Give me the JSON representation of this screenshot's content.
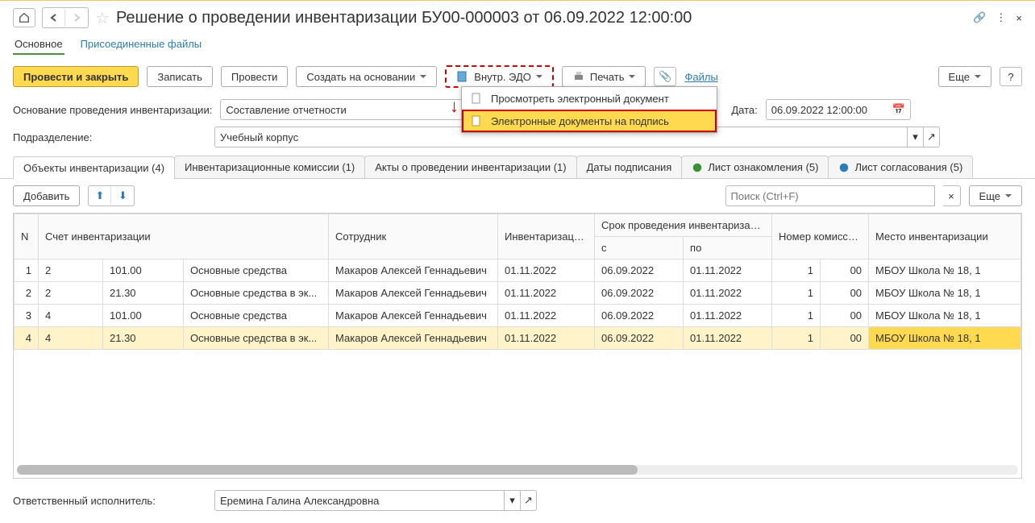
{
  "title": "Решение о проведении инвентаризации БУ00-000003 от 06.09.2022 12:00:00",
  "nav_tabs": {
    "main": "Основное",
    "attached": "Присоединенные файлы"
  },
  "toolbar": {
    "post_close": "Провести и закрыть",
    "save": "Записать",
    "post": "Провести",
    "create_based": "Создать на основании",
    "edo": "Внутр. ЭДО",
    "print": "Печать",
    "files": "Файлы",
    "more": "Еще"
  },
  "dropdown": {
    "view": "Просмотреть электронный документ",
    "sign": "Электронные документы на подпись"
  },
  "fields": {
    "basis_label": "Основание проведения инвентаризации:",
    "basis_value": "Составление отчетности",
    "date_label": "Дата:",
    "date_value": "06.09.2022 12:00:00",
    "dept_label": "Подразделение:",
    "dept_value": "Учебный корпус",
    "responsible_label": "Ответственный исполнитель:",
    "responsible_value": "Еремина Галина Александровна"
  },
  "sub_tabs": {
    "objects": "Объекты инвентаризации (4)",
    "commissions": "Инвентаризационные комиссии (1)",
    "acts": "Акты о проведении инвентаризации (1)",
    "sign_dates": "Даты подписания",
    "ack_sheet": "Лист ознакомления (5)",
    "approval_sheet": "Лист согласования (5)"
  },
  "grid_toolbar": {
    "add": "Добавить",
    "search_ph": "Поиск (Ctrl+F)",
    "more": "Еще"
  },
  "columns": {
    "n": "N",
    "account": "Счет инвентаризации",
    "employee": "Сотрудник",
    "inv_date": "Инвентаризация по состоянию на",
    "period": "Срок проведения инвентаризации",
    "from": "с",
    "to": "по",
    "commission": "Номер комиссии / рабочей комиссии",
    "place": "Место инвентаризации"
  },
  "rows": [
    {
      "n": "1",
      "a": "2",
      "b": "101.00",
      "c": "Основные средства",
      "emp": "Макаров Алексей Геннадьевич",
      "inv": "01.11.2022",
      "from": "06.09.2022",
      "to": "01.11.2022",
      "k1": "1",
      "k2": "00",
      "place": "МБОУ Школа № 18, 1"
    },
    {
      "n": "2",
      "a": "2",
      "b": "21.30",
      "c": "Основные средства в эк...",
      "emp": "Макаров Алексей Геннадьевич",
      "inv": "01.11.2022",
      "from": "06.09.2022",
      "to": "01.11.2022",
      "k1": "1",
      "k2": "00",
      "place": "МБОУ Школа № 18, 1"
    },
    {
      "n": "3",
      "a": "4",
      "b": "101.00",
      "c": "Основные средства",
      "emp": "Макаров Алексей Геннадьевич",
      "inv": "01.11.2022",
      "from": "06.09.2022",
      "to": "01.11.2022",
      "k1": "1",
      "k2": "00",
      "place": "МБОУ Школа № 18, 1"
    },
    {
      "n": "4",
      "a": "4",
      "b": "21.30",
      "c": "Основные средства в эк...",
      "emp": "Макаров Алексей Геннадьевич",
      "inv": "01.11.2022",
      "from": "06.09.2022",
      "to": "01.11.2022",
      "k1": "1",
      "k2": "00",
      "place": "МБОУ Школа № 18, 1"
    }
  ]
}
